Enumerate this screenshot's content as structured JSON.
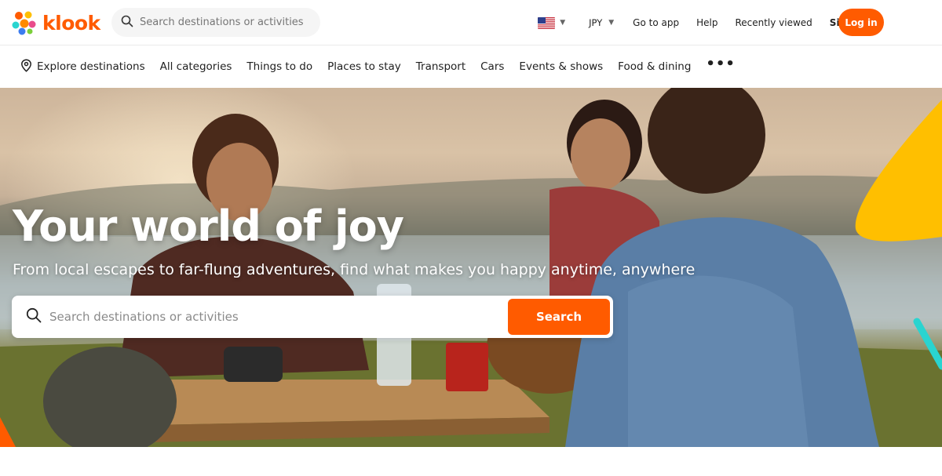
{
  "brand": {
    "name": "klook",
    "color": "#ff5b00"
  },
  "header": {
    "search_placeholder": "Search destinations or activities",
    "language_icon": "us-flag-icon",
    "currency": "JPY",
    "links": [
      "Go to app",
      "Help",
      "Recently viewed"
    ],
    "signup": "Sign up",
    "login": "Log in"
  },
  "nav": {
    "explore": "Explore destinations",
    "items": [
      "All categories",
      "Things to do",
      "Places to stay",
      "Transport",
      "Cars",
      "Events & shows",
      "Food & dining"
    ],
    "more_icon": "more-dots-icon"
  },
  "hero": {
    "title": "Your world of joy",
    "subtitle": "From local escapes to far-flung adventures, find what makes you happy anytime, anywhere",
    "search_placeholder": "Search destinations or activities",
    "search_button": "Search"
  },
  "colors": {
    "accent": "#ff5b00",
    "hero_shape_yellow": "#ffbf00",
    "hero_shape_teal": "#2ad4d0"
  }
}
